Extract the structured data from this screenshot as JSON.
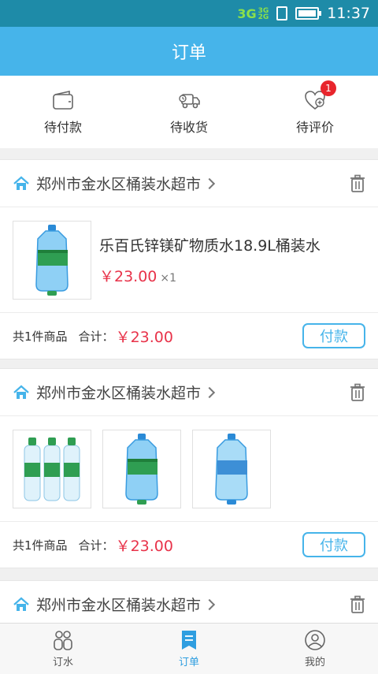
{
  "status_bar": {
    "network": "3G",
    "network_small_top": "3G",
    "network_small_bottom": "2G",
    "time": "11:37"
  },
  "title": "订单",
  "status_tabs": [
    {
      "label": "待付款",
      "icon": "wallet-icon"
    },
    {
      "label": "待收货",
      "icon": "delivery-truck-icon"
    },
    {
      "label": "待评价",
      "icon": "heart-review-icon",
      "badge": "1"
    }
  ],
  "orders": [
    {
      "shop": "郑州市金水区桶装水超市",
      "product_name": "乐百氏锌镁矿物质水18.9L桶装水",
      "price": "￥23.00",
      "qty": "×1",
      "count_text": "共1件商品",
      "total_label": "合计：",
      "total": "￥23.00",
      "pay_label": "付款"
    },
    {
      "shop": "郑州市金水区桶装水超市",
      "count_text": "共1件商品",
      "total_label": "合计：",
      "total": "￥23.00",
      "pay_label": "付款"
    },
    {
      "shop": "郑州市金水区桶装水超市"
    }
  ],
  "bottom_nav": [
    {
      "label": "订水",
      "icon": "people-icon"
    },
    {
      "label": "订单",
      "icon": "order-list-icon",
      "active": true
    },
    {
      "label": "我的",
      "icon": "profile-icon"
    }
  ],
  "colors": {
    "accent": "#46b4ea",
    "status_bar": "#1e8ba8",
    "price": "#e8334a",
    "badge": "#e8252c"
  }
}
